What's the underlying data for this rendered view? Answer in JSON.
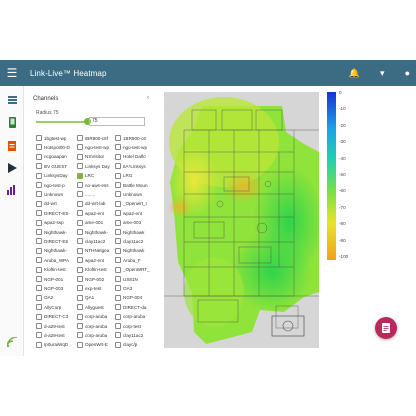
{
  "appbar": {
    "title": "Link-Live™ Heatmap",
    "menu_icon": "menu-icon",
    "bell_icon": "bell-icon",
    "account_icon": "account-icon",
    "bg": "#3b6c84"
  },
  "sidebar": {
    "items": [
      {
        "icon": "list-icon"
      },
      {
        "icon": "device-icon"
      },
      {
        "icon": "document-icon"
      },
      {
        "icon": "play-icon"
      },
      {
        "icon": "bar-chart-icon"
      },
      {
        "icon": "signal-icon"
      }
    ]
  },
  "panel": {
    "header": "Channels",
    "radius_label": "Radius 75",
    "radius_value": "75",
    "networks": [
      [
        "1bgtest-wp",
        "IBR900-c6f",
        "1BR900-c6"
      ],
      [
        "Hotspot00-D",
        "ngo-test-wp",
        "ngo-test-wp"
      ],
      [
        "ncgoaapan",
        "NSVisitor",
        "Hotel Dalfo"
      ],
      [
        "BV GUEST",
        "Linksys Day",
        "6A*Linksys"
      ],
      [
        "LinksysDay",
        "LRC",
        "LRG"
      ],
      [
        "ngo-test-p",
        "no-aws-ess",
        "Battle Moun"
      ],
      [
        "Unknown",
        "........",
        "Unknown"
      ],
      [
        "dd-wrt",
        "dd-wrt-lab",
        "_Openwrt_t"
      ],
      [
        "DIRECT-E5-",
        "wpa2-ent",
        "wpa2-ent"
      ],
      [
        "wpa2-ssp",
        "ame-001",
        "ame-003"
      ],
      [
        "Nighthawk-",
        "Nighthawk-",
        "Nighthawk"
      ],
      [
        "DIRECT-E5",
        "clay11ac2",
        "clay11ac2"
      ],
      [
        "Nighthawk-",
        "NTHNetgea",
        "Nighthawk"
      ],
      [
        "Aruba_WPA",
        "wpa2-ent",
        "Aruba_F"
      ],
      [
        "Kloftin-test",
        "Kloftin-test",
        "_OpenWRT_"
      ],
      [
        "NGP-001",
        "NGP-002",
        "US81N"
      ],
      [
        "NGP-003",
        "exp-test",
        "OA3"
      ],
      [
        "OA2",
        "QA1",
        "NGP-004"
      ],
      [
        "AllyCorp",
        "Allyguest",
        "DIRECT-da"
      ],
      [
        "DIRECT-C3",
        "corp-aruba",
        "corp-aruba"
      ],
      [
        "d-a29-test",
        "corp-aruba",
        "corp-test"
      ],
      [
        "d-a29-test",
        "corp-aruba",
        "clay11ac2"
      ],
      [
        "Ip0uraiWqD",
        "OpenWrt-E",
        "clayc/p"
      ]
    ],
    "checked": [
      [
        4,
        1
      ]
    ]
  },
  "legend": {
    "ticks": [
      "0",
      "-10",
      "-20",
      "-30",
      "-40",
      "-50",
      "-60",
      "-70",
      "-80",
      "-90",
      "-100"
    ],
    "colors": [
      "#1535d6",
      "#1aa3e6",
      "#1fd0b0",
      "#7fe040",
      "#e8e32a",
      "#f2a11a"
    ]
  },
  "fab": {
    "icon": "report-icon",
    "color": "#b9295b"
  }
}
